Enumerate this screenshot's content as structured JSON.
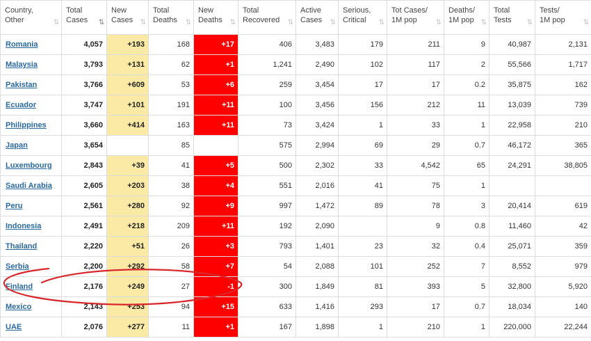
{
  "headers": [
    {
      "line1": "Country,",
      "line2": "Other"
    },
    {
      "line1": "Total",
      "line2": "Cases",
      "active": true
    },
    {
      "line1": "New",
      "line2": "Cases"
    },
    {
      "line1": "Total",
      "line2": "Deaths"
    },
    {
      "line1": "New",
      "line2": "Deaths"
    },
    {
      "line1": "Total",
      "line2": "Recovered"
    },
    {
      "line1": "Active",
      "line2": "Cases"
    },
    {
      "line1": "Serious,",
      "line2": "Critical"
    },
    {
      "line1": "Tot Cases/",
      "line2": "1M pop"
    },
    {
      "line1": "Deaths/",
      "line2": "1M pop"
    },
    {
      "line1": "Total",
      "line2": "Tests"
    },
    {
      "line1": "Tests/",
      "line2": "1M pop"
    }
  ],
  "sort_icon": "⇅",
  "sort_icon_active": "⇅",
  "rows": [
    {
      "country": "Romania",
      "total_cases": "4,057",
      "new_cases": "+193",
      "total_deaths": "168",
      "new_deaths": "+17",
      "total_recovered": "406",
      "active_cases": "3,483",
      "serious": "179",
      "cases_per_1m": "211",
      "deaths_per_1m": "9",
      "total_tests": "40,987",
      "tests_per_1m": "2,131"
    },
    {
      "country": "Malaysia",
      "total_cases": "3,793",
      "new_cases": "+131",
      "total_deaths": "62",
      "new_deaths": "+1",
      "total_recovered": "1,241",
      "active_cases": "2,490",
      "serious": "102",
      "cases_per_1m": "117",
      "deaths_per_1m": "2",
      "total_tests": "55,566",
      "tests_per_1m": "1,717"
    },
    {
      "country": "Pakistan",
      "total_cases": "3,766",
      "new_cases": "+609",
      "total_deaths": "53",
      "new_deaths": "+6",
      "total_recovered": "259",
      "active_cases": "3,454",
      "serious": "17",
      "cases_per_1m": "17",
      "deaths_per_1m": "0.2",
      "total_tests": "35,875",
      "tests_per_1m": "162"
    },
    {
      "country": "Ecuador",
      "total_cases": "3,747",
      "new_cases": "+101",
      "total_deaths": "191",
      "new_deaths": "+11",
      "total_recovered": "100",
      "active_cases": "3,456",
      "serious": "156",
      "cases_per_1m": "212",
      "deaths_per_1m": "11",
      "total_tests": "13,039",
      "tests_per_1m": "739"
    },
    {
      "country": "Philippines",
      "total_cases": "3,660",
      "new_cases": "+414",
      "total_deaths": "163",
      "new_deaths": "+11",
      "total_recovered": "73",
      "active_cases": "3,424",
      "serious": "1",
      "cases_per_1m": "33",
      "deaths_per_1m": "1",
      "total_tests": "22,958",
      "tests_per_1m": "210"
    },
    {
      "country": "Japan",
      "total_cases": "3,654",
      "new_cases": "",
      "total_deaths": "85",
      "new_deaths": "",
      "total_recovered": "575",
      "active_cases": "2,994",
      "serious": "69",
      "cases_per_1m": "29",
      "deaths_per_1m": "0.7",
      "total_tests": "46,172",
      "tests_per_1m": "365"
    },
    {
      "country": "Luxembourg",
      "total_cases": "2,843",
      "new_cases": "+39",
      "total_deaths": "41",
      "new_deaths": "+5",
      "total_recovered": "500",
      "active_cases": "2,302",
      "serious": "33",
      "cases_per_1m": "4,542",
      "deaths_per_1m": "65",
      "total_tests": "24,291",
      "tests_per_1m": "38,805"
    },
    {
      "country": "Saudi Arabia",
      "total_cases": "2,605",
      "new_cases": "+203",
      "total_deaths": "38",
      "new_deaths": "+4",
      "total_recovered": "551",
      "active_cases": "2,016",
      "serious": "41",
      "cases_per_1m": "75",
      "deaths_per_1m": "1",
      "total_tests": "",
      "tests_per_1m": ""
    },
    {
      "country": "Peru",
      "total_cases": "2,561",
      "new_cases": "+280",
      "total_deaths": "92",
      "new_deaths": "+9",
      "total_recovered": "997",
      "active_cases": "1,472",
      "serious": "89",
      "cases_per_1m": "78",
      "deaths_per_1m": "3",
      "total_tests": "20,414",
      "tests_per_1m": "619"
    },
    {
      "country": "Indonesia",
      "total_cases": "2,491",
      "new_cases": "+218",
      "total_deaths": "209",
      "new_deaths": "+11",
      "total_recovered": "192",
      "active_cases": "2,090",
      "serious": "",
      "cases_per_1m": "9",
      "deaths_per_1m": "0.8",
      "total_tests": "11,460",
      "tests_per_1m": "42"
    },
    {
      "country": "Thailand",
      "total_cases": "2,220",
      "new_cases": "+51",
      "total_deaths": "26",
      "new_deaths": "+3",
      "total_recovered": "793",
      "active_cases": "1,401",
      "serious": "23",
      "cases_per_1m": "32",
      "deaths_per_1m": "0.4",
      "total_tests": "25,071",
      "tests_per_1m": "359"
    },
    {
      "country": "Serbia",
      "total_cases": "2,200",
      "new_cases": "+292",
      "total_deaths": "58",
      "new_deaths": "+7",
      "total_recovered": "54",
      "active_cases": "2,088",
      "serious": "101",
      "cases_per_1m": "252",
      "deaths_per_1m": "7",
      "total_tests": "8,552",
      "tests_per_1m": "979"
    },
    {
      "country": "Finland",
      "total_cases": "2,176",
      "new_cases": "+249",
      "total_deaths": "27",
      "new_deaths": "-1",
      "total_recovered": "300",
      "active_cases": "1,849",
      "serious": "81",
      "cases_per_1m": "393",
      "deaths_per_1m": "5",
      "total_tests": "32,800",
      "tests_per_1m": "5,920"
    },
    {
      "country": "Mexico",
      "total_cases": "2,143",
      "new_cases": "+253",
      "total_deaths": "94",
      "new_deaths": "+15",
      "total_recovered": "633",
      "active_cases": "1,416",
      "serious": "293",
      "cases_per_1m": "17",
      "deaths_per_1m": "0.7",
      "total_tests": "18,034",
      "tests_per_1m": "140"
    },
    {
      "country": "UAE",
      "total_cases": "2,076",
      "new_cases": "+277",
      "total_deaths": "11",
      "new_deaths": "+1",
      "total_recovered": "167",
      "active_cases": "1,898",
      "serious": "1",
      "cases_per_1m": "210",
      "deaths_per_1m": "1",
      "total_tests": "220,000",
      "tests_per_1m": "22,244"
    }
  ],
  "colors": {
    "link": "#2a69a0",
    "new_cases_bg": "#fbe9a6",
    "new_deaths_bg": "#ff0000",
    "annotation_circle": "#d9262b"
  }
}
